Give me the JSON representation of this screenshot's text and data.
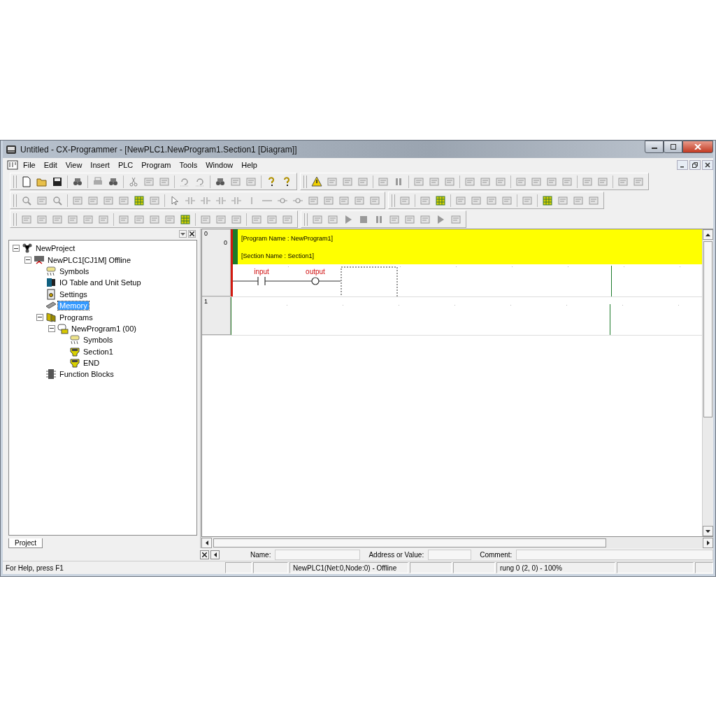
{
  "window": {
    "title": "Untitled - CX-Programmer - [NewPLC1.NewProgram1.Section1 [Diagram]]"
  },
  "menu": [
    "File",
    "Edit",
    "View",
    "Insert",
    "PLC",
    "Program",
    "Tools",
    "Window",
    "Help"
  ],
  "project_tree": {
    "items": [
      {
        "label": "NewProject",
        "kind": "project",
        "selected": false,
        "expanded": true,
        "children": [
          {
            "label": "NewPLC1[CJ1M] Offline",
            "kind": "plc",
            "selected": false,
            "expanded": true,
            "children": [
              {
                "label": "Symbols",
                "kind": "symbols",
                "selected": false
              },
              {
                "label": "IO Table and Unit Setup",
                "kind": "io-table",
                "selected": false
              },
              {
                "label": "Settings",
                "kind": "settings",
                "selected": false
              },
              {
                "label": "Memory",
                "kind": "memory",
                "selected": true
              },
              {
                "label": "Programs",
                "kind": "programs",
                "selected": false,
                "expanded": true,
                "children": [
                  {
                    "label": "NewProgram1 (00)",
                    "kind": "program",
                    "selected": false,
                    "expanded": true,
                    "children": [
                      {
                        "label": "Symbols",
                        "kind": "symbols",
                        "selected": false
                      },
                      {
                        "label": "Section1",
                        "kind": "section",
                        "selected": false
                      },
                      {
                        "label": "END",
                        "kind": "section",
                        "selected": false
                      }
                    ]
                  }
                ]
              },
              {
                "label": "Function Blocks",
                "kind": "function-blocks",
                "selected": false
              }
            ]
          }
        ]
      }
    ]
  },
  "tabs": [
    {
      "label": "Project",
      "selected": true
    }
  ],
  "diagram": {
    "rungs": [
      {
        "number": "0",
        "step": "0",
        "error": true,
        "comments": [
          "[Program Name : NewProgram1]",
          "[Section Name : Section1]"
        ],
        "elements": [
          {
            "kind": "contact",
            "label": "input"
          },
          {
            "kind": "coil",
            "label": "output"
          }
        ],
        "cursor": true
      },
      {
        "number": "1",
        "error": false
      }
    ]
  },
  "info_bar": {
    "fields": [
      {
        "label": "Name:"
      },
      {
        "label": "Address or Value:"
      },
      {
        "label": "Comment:"
      }
    ]
  },
  "status_bar": {
    "help": "For Help, press F1",
    "connection": "NewPLC1(Net:0,Node:0) - Offline",
    "position": "rung 0 (2, 0)  - 100%"
  }
}
